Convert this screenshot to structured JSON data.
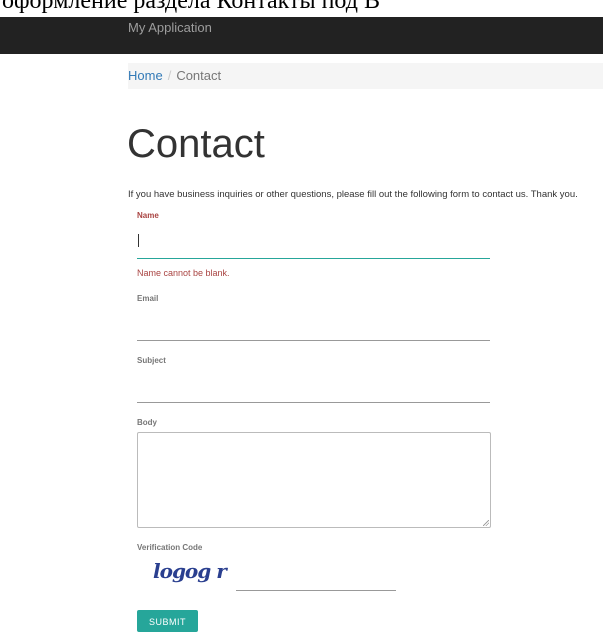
{
  "top_caption": "оформление раздела Контакты под В",
  "navbar": {
    "brand": "My Application"
  },
  "breadcrumb": {
    "home": "Home",
    "separator": "/",
    "current": "Contact"
  },
  "page": {
    "title": "Contact",
    "intro": "If you have business inquiries or other questions, please fill out the following form to contact us. Thank you."
  },
  "form": {
    "name_label": "Name",
    "name_error": "Name cannot be blank.",
    "email_label": "Email",
    "subject_label": "Subject",
    "body_label": "Body",
    "verification_label": "Verification Code",
    "captcha_text": "logog r",
    "submit_label": "SUBMIT"
  },
  "colors": {
    "accent": "#26a69a",
    "error": "#a94442",
    "navbar": "#222222",
    "link": "#337ab7"
  }
}
